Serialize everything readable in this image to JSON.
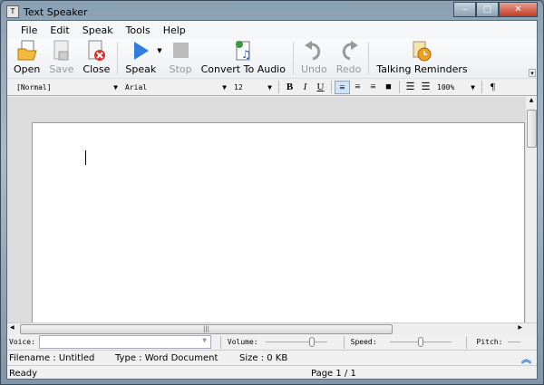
{
  "window": {
    "title": "Text Speaker"
  },
  "menu": [
    "File",
    "Edit",
    "Speak",
    "Tools",
    "Help"
  ],
  "toolbar": {
    "open": "Open",
    "save": "Save",
    "close": "Close",
    "speak": "Speak",
    "stop": "Stop",
    "convert": "Convert To Audio",
    "undo": "Undo",
    "redo": "Redo",
    "reminders": "Talking Reminders"
  },
  "format": {
    "style": "[Normal]",
    "font": "Arial",
    "size": "12",
    "bold": "B",
    "italic": "I",
    "underline": "U",
    "zoom": "100%",
    "pilcrow": "¶"
  },
  "voicebar": {
    "voice_label": "Voice:",
    "voice_value": "",
    "volume_label": "Volume:",
    "volume": 0.75,
    "speed_label": "Speed:",
    "speed": 0.5,
    "pitch_label": "Pitch:"
  },
  "info": {
    "filename": "Filename : Untitled",
    "type": "Type : Word Document",
    "size": "Size : 0 KB"
  },
  "status": {
    "state": "Ready",
    "page": "Page 1 / 1"
  }
}
